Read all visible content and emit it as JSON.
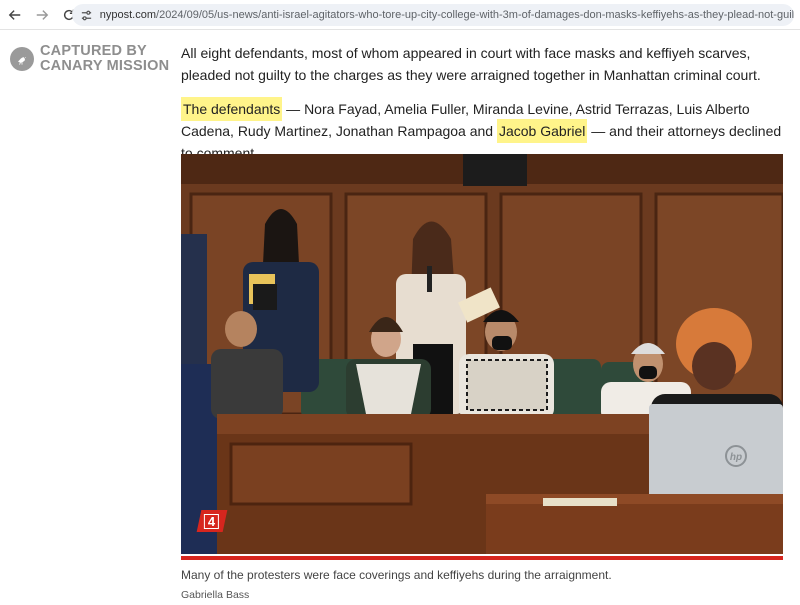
{
  "browser": {
    "url_host": "nypost.com",
    "url_path": "/2024/09/05/us-news/anti-israel-agitators-who-tore-up-city-college-with-3m-of-damages-don-masks-keffiyehs-as-they-plead-not-guilty/",
    "back_icon": "arrow-left-icon",
    "forward_icon": "arrow-right-icon",
    "reload_icon": "reload-icon",
    "site_info_icon": "tune-icon"
  },
  "watermark": {
    "line1": "CAPTURED BY",
    "line2": "CANARY MISSION",
    "logo_icon": "canary-bird-icon"
  },
  "article": {
    "para1": "All eight defendants, most of whom appeared in court with face masks and keffiyeh scarves, pleaded not guilty to the charges as they were arraigned together in Manhattan criminal court.",
    "para2_hl1": "The defendants",
    "para2_mid": " — Nora Fayad, Amelia Fuller, Miranda Levine, Astrid Terrazas, Luis Alberto Cadena, Rudy Martinez, Jonathan Rampagoa and ",
    "para2_hl2": "Jacob Gabriel",
    "para2_end": " — and their attorneys declined to comment.",
    "highlight_color": "#fff48a"
  },
  "photo": {
    "badge": "4",
    "laptop_logo": "hp",
    "accent_color": "#d7261e"
  },
  "caption": "Many of the protesters were face coverings and keffiyehs during the arraignment.",
  "credit": "Gabriella Bass"
}
